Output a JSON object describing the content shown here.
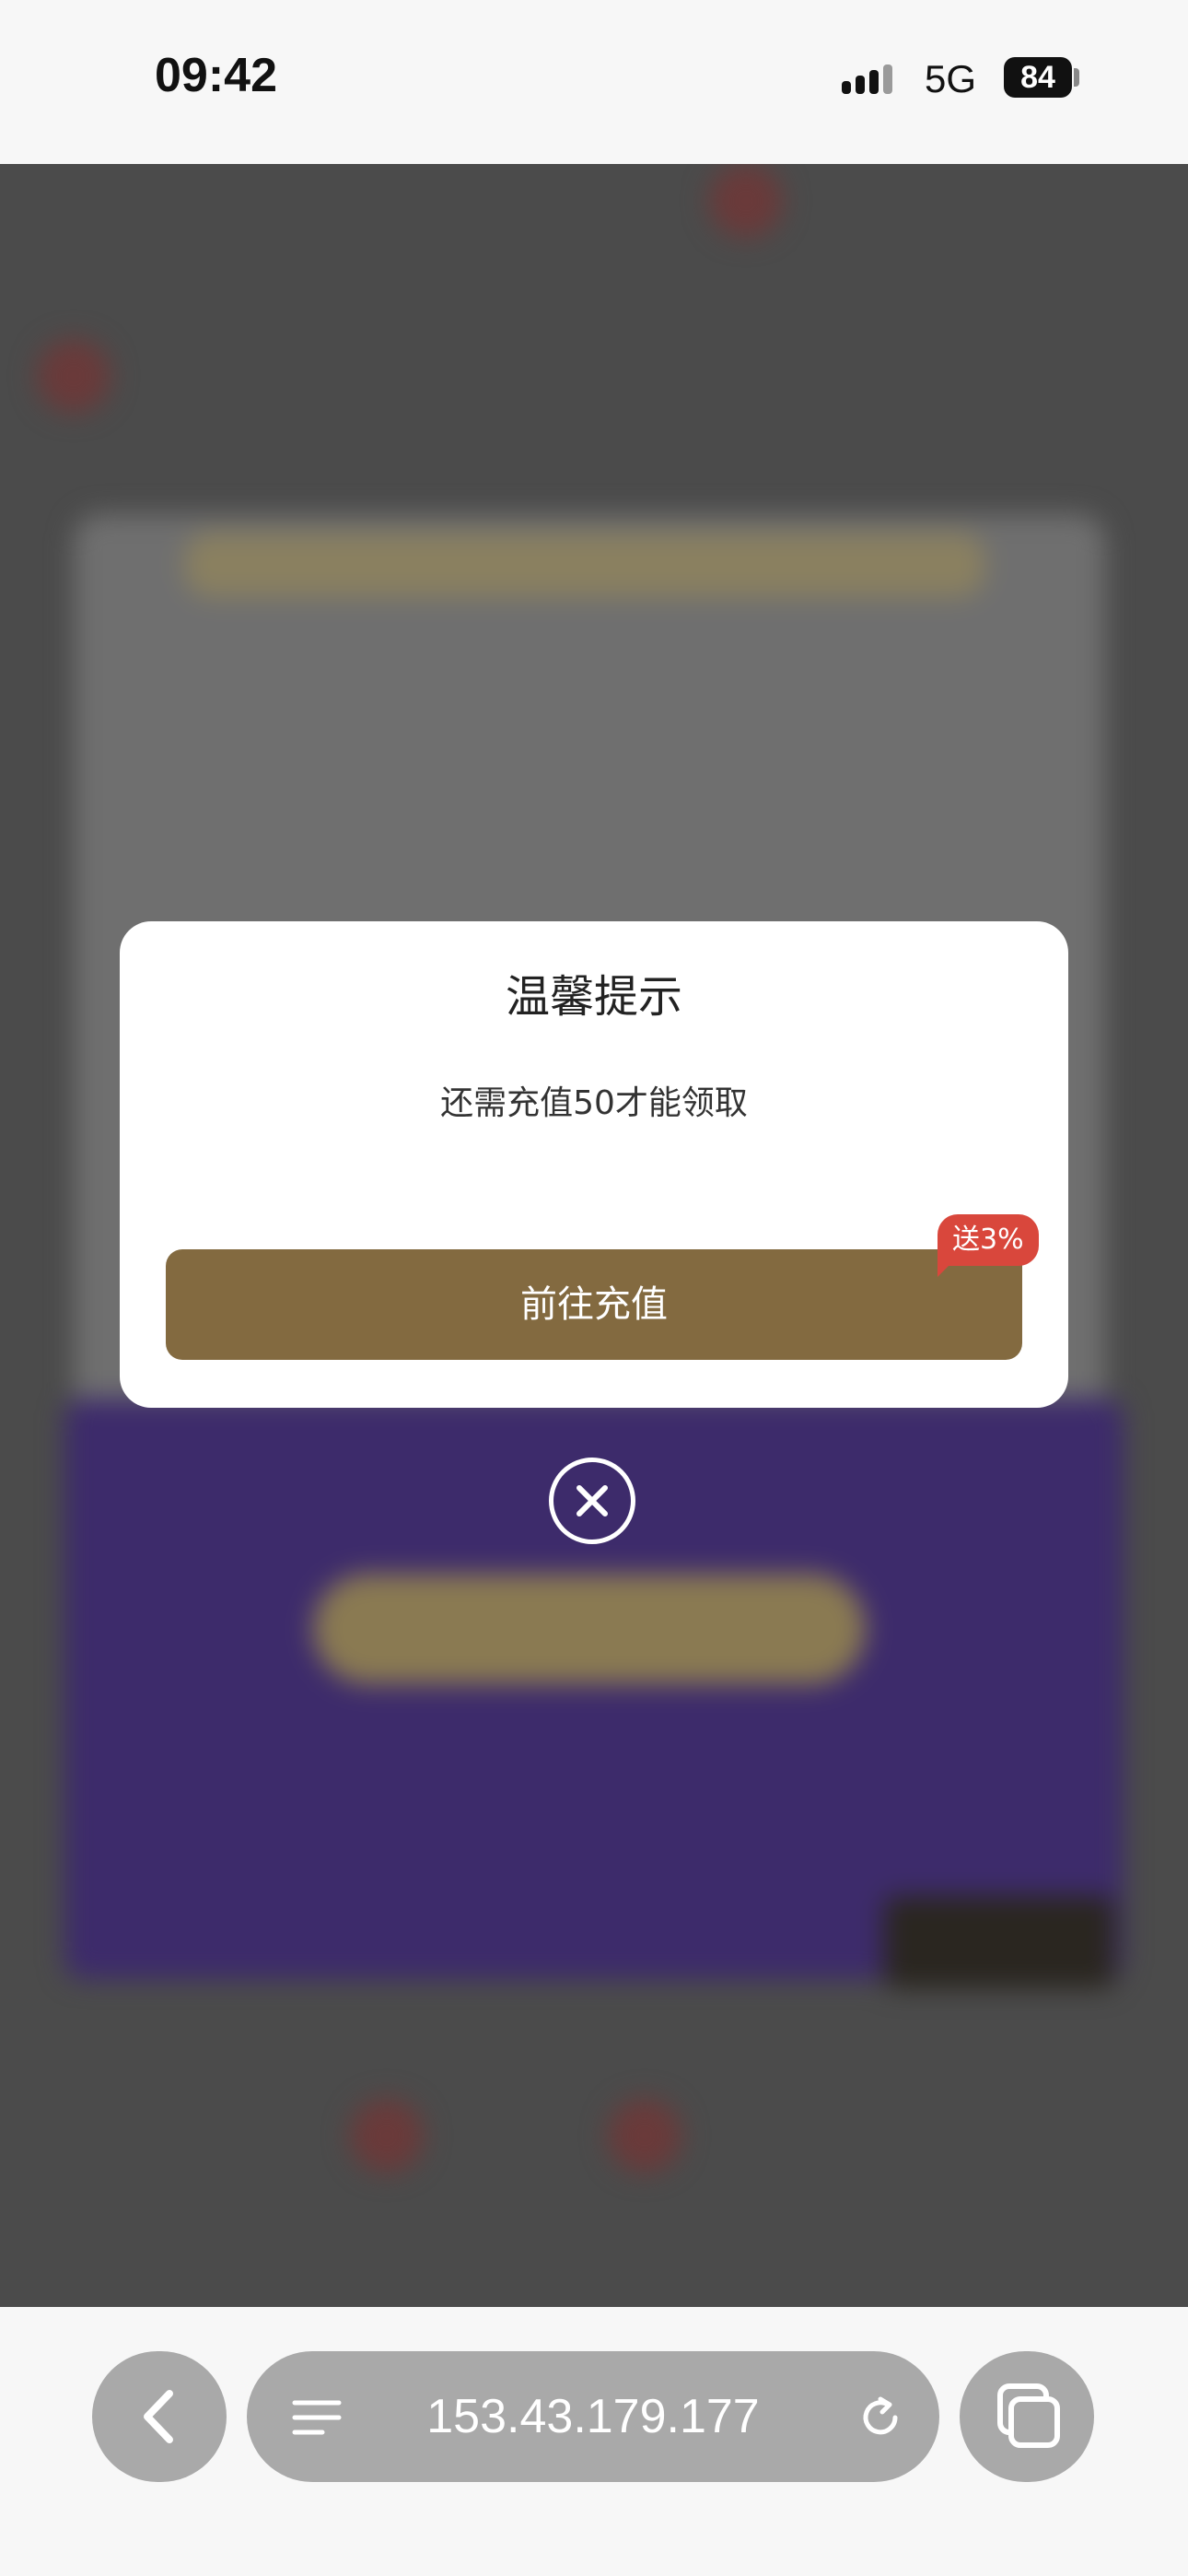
{
  "status_bar": {
    "time": "09:42",
    "network": "5G",
    "battery": "84"
  },
  "dialog": {
    "title": "温馨提示",
    "message": "还需充值50才能领取",
    "button_label": "前往充值",
    "badge": "送3%"
  },
  "browser": {
    "url": "153.43.179.177"
  },
  "colors": {
    "button": "#836a40",
    "badge": "#d9473c",
    "overlay": "#4b4b4b"
  },
  "icons": {
    "close": "close-circle-icon",
    "back": "chevron-left-icon",
    "menu": "menu-icon",
    "reload": "reload-icon",
    "tabs": "tabs-icon"
  }
}
